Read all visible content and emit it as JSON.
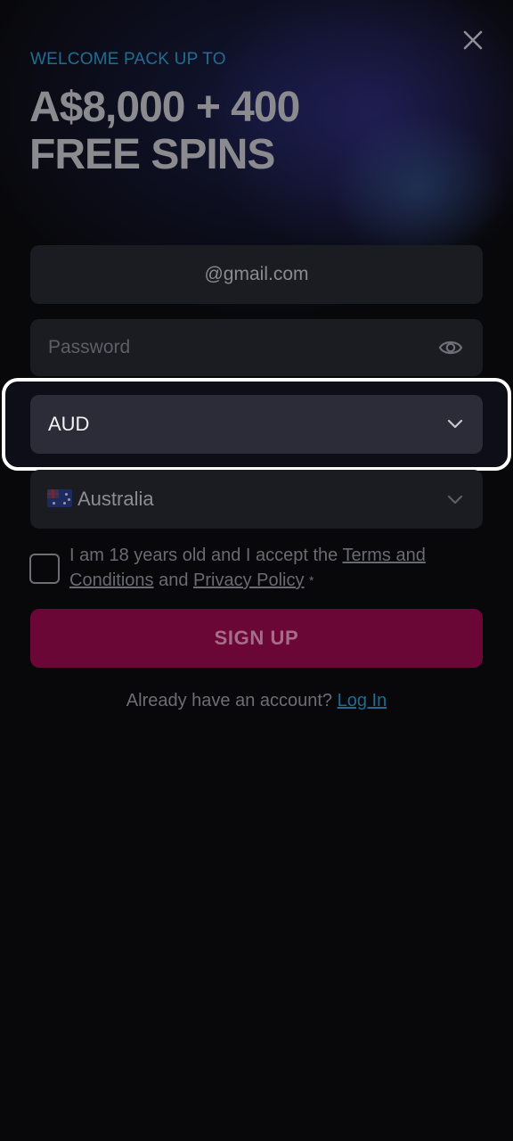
{
  "header": {
    "subtitle": "WELCOME PACK UP TO",
    "title_line1": "A$8,000 + 400",
    "title_line2": "FREE SPINS"
  },
  "form": {
    "email_value": "@gmail.com",
    "password_placeholder": "Password",
    "currency_value": "AUD",
    "country_value": "Australia",
    "terms_prefix": "I am 18 years old and I accept the ",
    "terms_link": "Terms and Conditions",
    "terms_mid": " and ",
    "privacy_link": "Privacy Policy",
    "required_mark": "*",
    "signup_label": "SIGN UP",
    "login_prompt": "Already have an account? ",
    "login_link": "Log In"
  },
  "icons": {
    "close": "close-icon",
    "password_toggle": "eye-icon",
    "dropdown": "chevron-down-icon",
    "flag": "australia-flag-icon"
  },
  "colors": {
    "accent_blue": "#1e6e94",
    "signup_button": "#6a0737",
    "selected_field": "#2b2c38",
    "highlight_border": "#ffffff"
  }
}
